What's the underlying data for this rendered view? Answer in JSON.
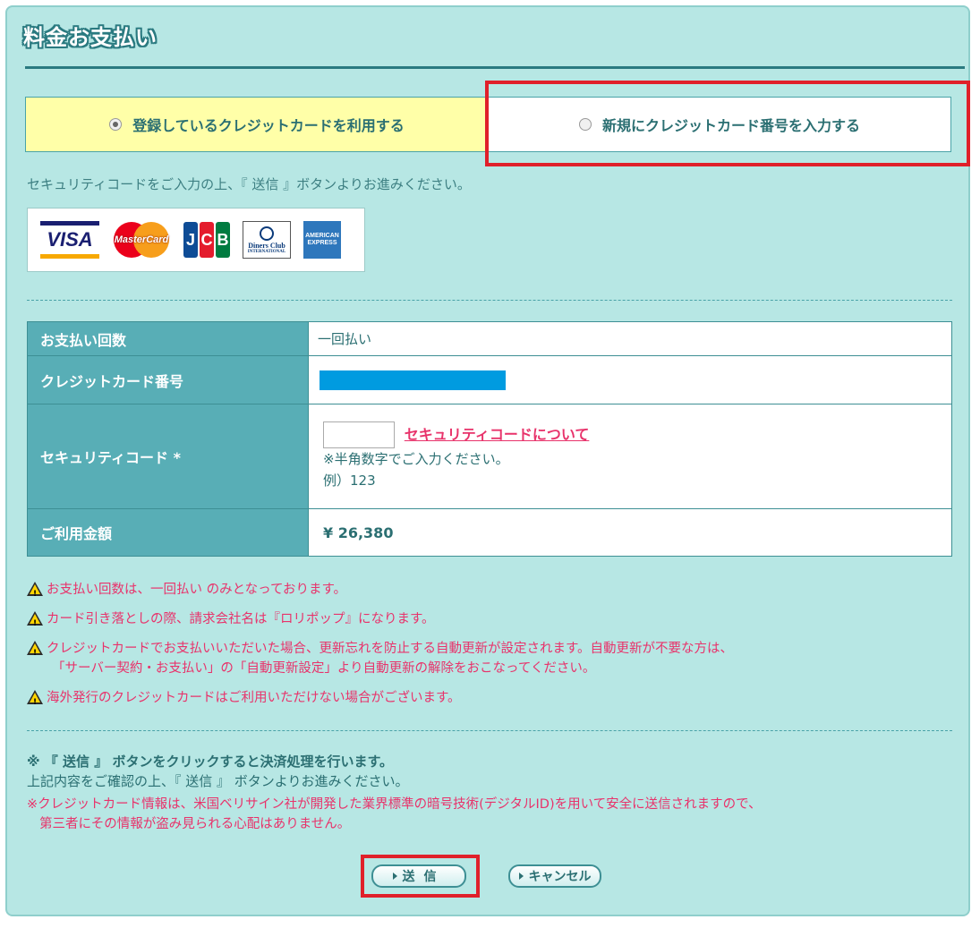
{
  "page": {
    "title": "料金お支払い"
  },
  "tabs": {
    "registered_label": "登録しているクレジットカードを利用する",
    "new_label": "新規にクレジットカード番号を入力する"
  },
  "intro_text": "セキュリティコードをご入力の上、『 送信 』ボタンよりお進みください。",
  "brands": {
    "visa": "VISA",
    "mastercard": "MasterCard",
    "jcb": [
      "J",
      "C",
      "B"
    ],
    "jcb_colors": [
      "#0e4c96",
      "#e41c2d",
      "#007b40"
    ],
    "diners_line1": "Diners Club",
    "diners_line2": "INTERNATIONAL",
    "amex_line1": "AMERICAN",
    "amex_line2": "EXPRESS"
  },
  "form": {
    "installments_label": "お支払い回数",
    "installments_value": "一回払い",
    "card_number_label": "クレジットカード番号",
    "security_code_label": "セキュリティコード *",
    "security_code_link": "セキュリティコードについて",
    "security_hint1": "※半角数字でご入力ください。",
    "security_hint2": "例）123",
    "amount_label": "ご利用金額",
    "amount_value": "¥ 26,380"
  },
  "notes": {
    "n1": "お支払い回数は、一回払い のみとなっております。",
    "n2": "カード引き落としの際、請求会社名は『ロリポップ』になります。",
    "n3a": "クレジットカードでお支払いいただいた場合、更新忘れを防止する自動更新が設定されます。自動更新が不要な方は、",
    "n3b": "「サーバー契約・お支払い」の「自動更新設定」より自動更新の解除をおこなってください。",
    "n4": "海外発行のクレジットカードはご利用いただけない場合がございます。"
  },
  "bottom": {
    "line1": "※ 『 送信 』 ボタンをクリックすると決済処理を行います。",
    "line2": "上記内容をご確認の上、『 送信 』 ボタンよりお進みください。",
    "line3a": "※クレジットカード情報は、米国ベリサイン社が開発した業界標準の暗号技術(デジタルID)を用いて安全に送信されますので、",
    "line3b": "第三者にその情報が盗み見られる心配はありません。"
  },
  "buttons": {
    "send": "送信",
    "cancel": "キャンセル"
  },
  "colors": {
    "panel_bg": "#b7e7e4",
    "header_cell": "#58aeb6",
    "active_tab": "#ffffa8",
    "warning_text": "#e8336b",
    "highlight": "#e0202a"
  }
}
